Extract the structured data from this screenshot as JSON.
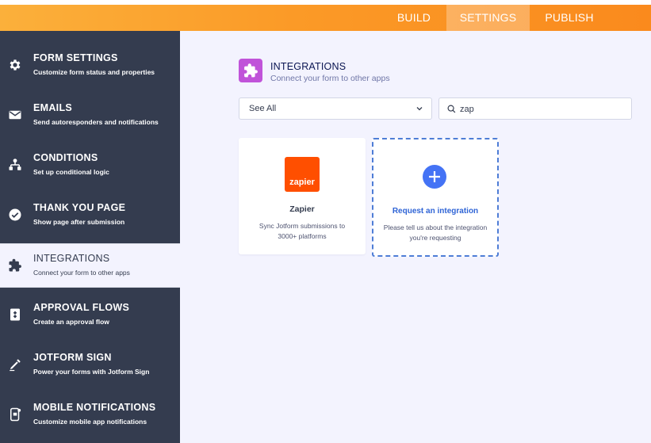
{
  "topbar": {
    "tabs": [
      {
        "label": "BUILD"
      },
      {
        "label": "SETTINGS"
      },
      {
        "label": "PUBLISH"
      }
    ],
    "active_tab": "SETTINGS"
  },
  "sidebar": {
    "items": [
      {
        "title": "FORM SETTINGS",
        "subtitle": "Customize form status and properties",
        "icon": "gear-icon"
      },
      {
        "title": "EMAILS",
        "subtitle": "Send autoresponders and notifications",
        "icon": "envelope-icon"
      },
      {
        "title": "CONDITIONS",
        "subtitle": "Set up conditional logic",
        "icon": "hierarchy-icon"
      },
      {
        "title": "THANK YOU PAGE",
        "subtitle": "Show page after submission",
        "icon": "check-circle-icon"
      },
      {
        "title": "INTEGRATIONS",
        "subtitle": "Connect your form to other apps",
        "icon": "puzzle-icon"
      },
      {
        "title": "APPROVAL FLOWS",
        "subtitle": "Create an approval flow",
        "icon": "approval-icon"
      },
      {
        "title": "JOTFORM SIGN",
        "subtitle": "Power your forms with Jotform Sign",
        "icon": "pen-icon"
      },
      {
        "title": "MOBILE NOTIFICATIONS",
        "subtitle": "Customize mobile app notifications",
        "icon": "mobile-icon"
      }
    ],
    "active_item": "INTEGRATIONS"
  },
  "main": {
    "header": {
      "title": "INTEGRATIONS",
      "subtitle": "Connect your form to other apps",
      "icon": "puzzle-icon",
      "icon_color": "#C053D9"
    },
    "filter": {
      "selected": "See All"
    },
    "search": {
      "value": "zap",
      "placeholder": ""
    },
    "cards": [
      {
        "logo_text": "zapier",
        "name": "Zapier",
        "description": "Sync Jotform submissions to 3000+ platforms",
        "logo_color": "#FF4F00"
      }
    ],
    "request_card": {
      "title": "Request an integration",
      "description": "Please tell us about the integration you're requesting",
      "accent_color": "#4473F5"
    }
  },
  "colors": {
    "topbar_orange": "#FA8A1D",
    "sidebar_bg": "#343C4F",
    "main_bg": "#F3F3FE"
  }
}
